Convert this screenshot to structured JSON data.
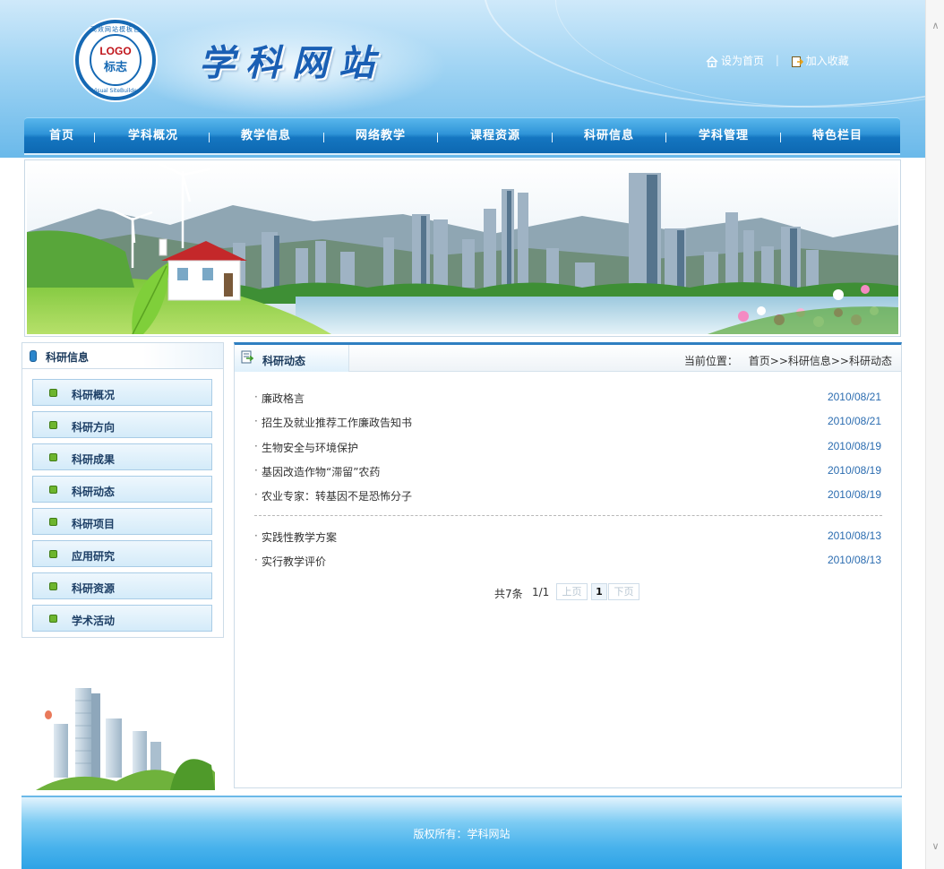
{
  "header": {
    "logo_text": "LOGO",
    "logo_sub": "标志",
    "logo_ring_top": "高效网站模板包",
    "logo_ring_bottom": "Visual SiteBuilder",
    "site_title": "学科网站",
    "set_home_label": "设为首页",
    "add_favorite_label": "加入收藏",
    "link_separator": "|"
  },
  "nav": {
    "items": [
      {
        "label": "首页"
      },
      {
        "label": "学科概况"
      },
      {
        "label": "教学信息"
      },
      {
        "label": "网络教学"
      },
      {
        "label": "课程资源"
      },
      {
        "label": "科研信息"
      },
      {
        "label": "学科管理"
      },
      {
        "label": "特色栏目"
      }
    ],
    "separator": "|"
  },
  "sidebar": {
    "title": "科研信息",
    "items": [
      {
        "label": "科研概况"
      },
      {
        "label": "科研方向"
      },
      {
        "label": "科研成果"
      },
      {
        "label": "科研动态"
      },
      {
        "label": "科研项目"
      },
      {
        "label": "应用研究"
      },
      {
        "label": "科研资源"
      },
      {
        "label": "学术活动"
      }
    ]
  },
  "main": {
    "tab_title": "科研动态",
    "breadcrumb": {
      "prefix": "当前位置：",
      "path": "首页>>科研信息>>科研动态"
    },
    "bullet": "·",
    "news": [
      {
        "title": "廉政格言",
        "date": "2010/08/21"
      },
      {
        "title": "招生及就业推荐工作廉政告知书",
        "date": "2010/08/21"
      },
      {
        "title": "生物安全与环境保护",
        "date": "2010/08/19"
      },
      {
        "title": "基因改造作物“滞留”农药",
        "date": "2010/08/19"
      },
      {
        "title": "农业专家：转基因不是恐怖分子",
        "date": "2010/08/19"
      },
      {
        "title": "实践性教学方案",
        "date": "2010/08/13"
      },
      {
        "title": "实行教学评价",
        "date": "2010/08/13"
      }
    ],
    "pager": {
      "total": "共7条",
      "page_info": "1/1",
      "prev_label": "上页",
      "current_page": "1",
      "next_label": "下页"
    }
  },
  "footer": {
    "copyright": "版权所有：学科网站"
  },
  "colors": {
    "brand_blue": "#1576c1",
    "link_date": "#2b6cb0",
    "menu_border": "#a9cce6"
  }
}
